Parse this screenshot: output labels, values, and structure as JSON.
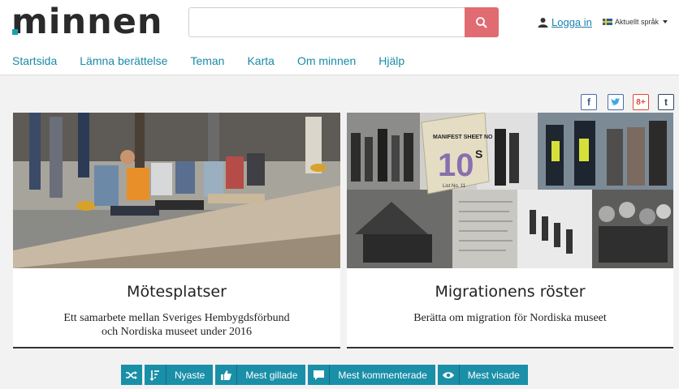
{
  "header": {
    "logo": "minnen",
    "search": {
      "placeholder": "",
      "value": ""
    },
    "login_label": "Logga in",
    "language_label": "Aktuellt språk"
  },
  "nav": {
    "items": [
      "Startsida",
      "Lämna berättelse",
      "Teman",
      "Karta",
      "Om minnen",
      "Hjälp"
    ]
  },
  "share": {
    "facebook": "f",
    "twitter": "t",
    "googleplus": "8+",
    "tumblr": "t"
  },
  "cards": [
    {
      "title": "Mötesplatser",
      "description_line1": "Ett samarbete mellan Sveriges Hembygdsförbund",
      "description_line2": "och Nordiska museet under 2016"
    },
    {
      "title": "Migrationens röster",
      "description_line1": "Berätta om migration för Nordiska museet",
      "manifest_text": "MANIFEST SHEET NO",
      "manifest_number": "10",
      "manifest_suffix": "S",
      "manifest_small": "List No. 11"
    }
  ],
  "filters": {
    "newest": "Nyaste",
    "most_liked": "Mest gillade",
    "most_commented": "Mest kommenterade",
    "most_viewed": "Mest visade"
  },
  "colors": {
    "accent": "#1a8fa8",
    "search_button": "#e06c72",
    "link": "#1a7fb0"
  }
}
